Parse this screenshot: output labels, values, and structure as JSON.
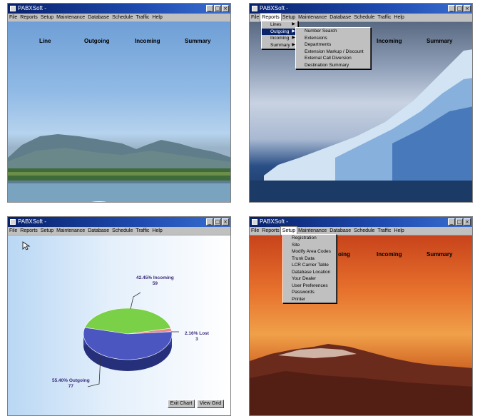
{
  "title": "PABXSoft -",
  "window_controls": {
    "minimize": "_",
    "maximize": "□",
    "close": "×"
  },
  "menu": [
    "File",
    "Reports",
    "Setup",
    "Maintenance",
    "Database",
    "Schedule",
    "Traffic",
    "Help"
  ],
  "headers": [
    "Line",
    "Outgoing",
    "Incoming",
    "Summary"
  ],
  "headers_partial": {
    "outgoing": "oing",
    "incoming": "Incoming",
    "summary": "Summary"
  },
  "reports_menu": [
    "Lines",
    "Outgoing",
    "Incoming",
    "Summary"
  ],
  "outgoing_submenu": [
    "Number Search",
    "Extensions",
    "Departments",
    "Extension Markup / Discount",
    "External Call Diversion",
    "Destination Summary"
  ],
  "setup_menu": [
    "Registration",
    "Site",
    "Modify Area Codes",
    "Trunk Data",
    "LCR Carrier Table",
    "Database Location",
    "Your Dealer",
    "User Preferences",
    "Passwords",
    "Printer"
  ],
  "chart_buttons": {
    "exit": "Exit Chart",
    "grid": "View Grid"
  },
  "chart_data": {
    "type": "pie",
    "slices": [
      {
        "label": "Incoming",
        "percent": 42.45,
        "count": "59",
        "color": "#7ad046"
      },
      {
        "label": "Lost",
        "percent": 2.16,
        "count": "3",
        "color": "#ee8888"
      },
      {
        "label": "Outgoing",
        "percent": 55.4,
        "count": "77",
        "color": "#4c56c0"
      }
    ],
    "slice_text": {
      "incoming": "42.45% Incoming",
      "lost": "2.16% Lost",
      "outgoing": "55.40% Outgoing"
    }
  }
}
